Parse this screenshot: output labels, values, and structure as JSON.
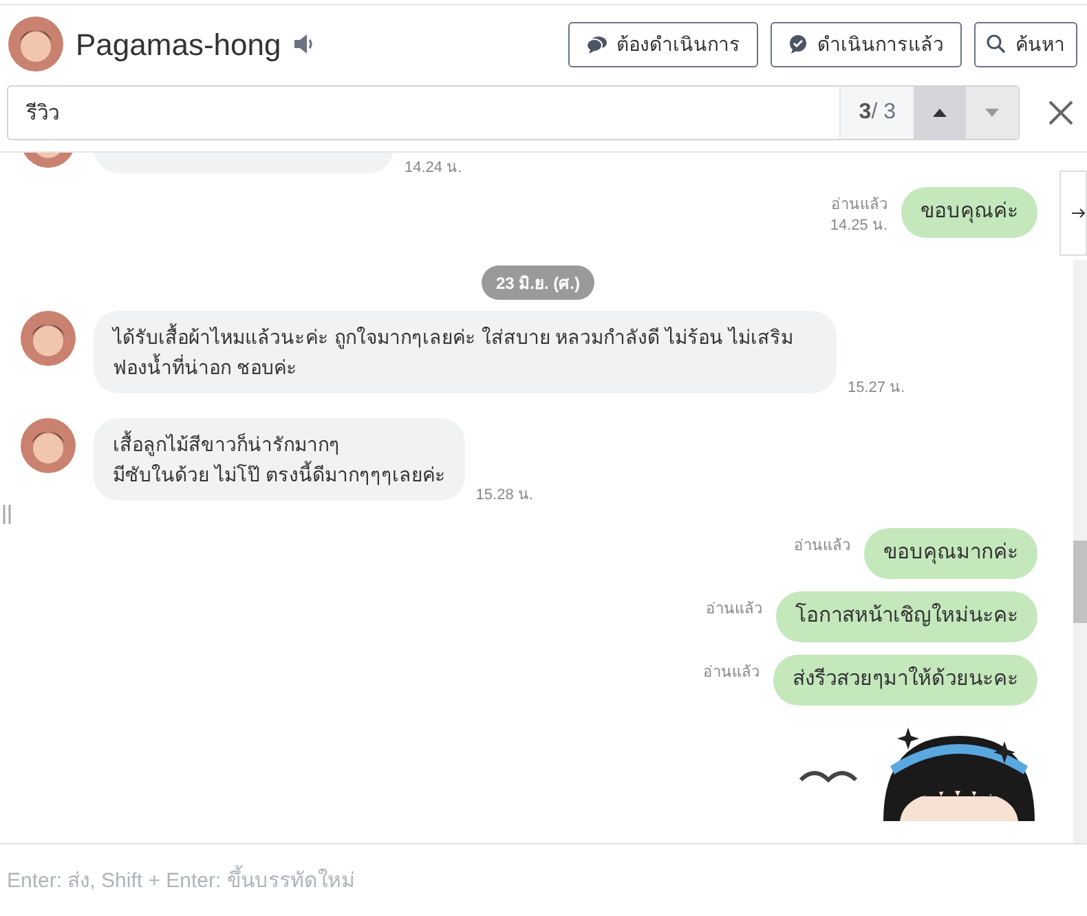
{
  "header": {
    "contact_name": "Pagamas-hong",
    "buttons": [
      {
        "kind": "pending",
        "label": "ต้องดำเนินการ"
      },
      {
        "kind": "done",
        "label": "ดำเนินการแล้ว"
      },
      {
        "kind": "search",
        "label": "ค้นหา"
      }
    ]
  },
  "search": {
    "value": "รีวิว",
    "current": "3",
    "total": "/ 3"
  },
  "messages": [
    {
      "kind": "incoming",
      "time": "14.24 น."
    },
    {
      "kind": "outgoing",
      "text": "ขอบคุณค่ะ",
      "read": "อ่านแล้ว",
      "time": "14.25 น."
    },
    {
      "kind": "date",
      "text": "23 มิ.ย. (ศ.)"
    },
    {
      "kind": "incoming",
      "text": "ได้รับเสื้อผ้าไหมแล้วนะค่ะ ถูกใจมากๆเลยค่ะ ใส่สบาย หลวมกำลังดี ไม่ร้อน ไม่เสริมฟองน้ำที่น่าอก ชอบค่ะ",
      "time": "15.27 น."
    },
    {
      "kind": "incoming",
      "text": "เสื้อลูกไม้สีขาวก็น่ารักมากๆ\nมีซับในด้วย ไม่โป๊ ตรงนี้ดีมากๆๆๆเลยค่ะ",
      "time": "15.28 น."
    },
    {
      "kind": "outgoing",
      "text": "ขอบคุณมากค่ะ",
      "read": "อ่านแล้ว"
    },
    {
      "kind": "outgoing",
      "text": "โอกาสหน้าเชิญใหม่นะคะ",
      "read": "อ่านแล้ว"
    },
    {
      "kind": "outgoing",
      "text": "ส่งรีวสวยๆมาให้ด้วยนะคะ",
      "read": "อ่านแล้ว"
    },
    {
      "kind": "sticker"
    }
  ],
  "composer": {
    "placeholder": "Enter: ส่ง, Shift + Enter: ขึ้นบรรทัดใหม่"
  }
}
